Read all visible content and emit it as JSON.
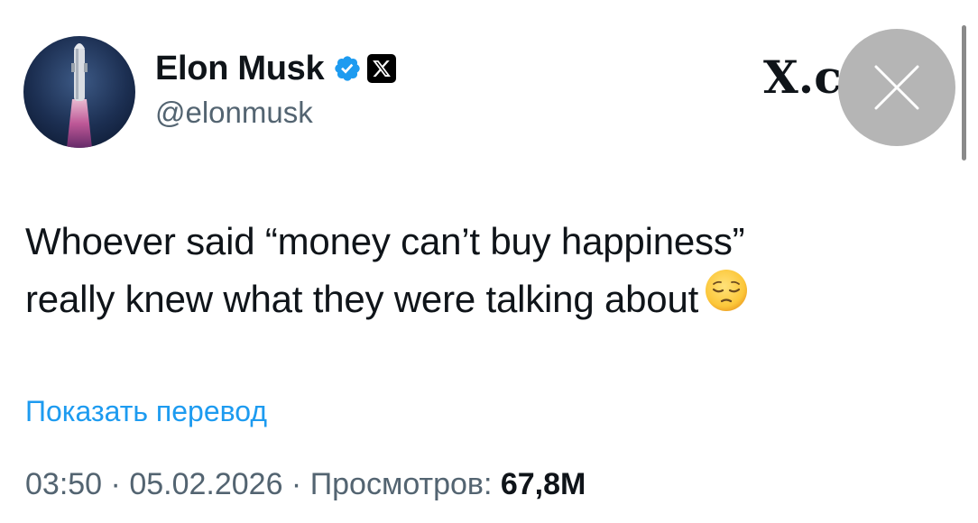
{
  "author": {
    "name": "Elon Musk",
    "handle": "@elonmusk",
    "avatar_icon": "rocket-launch-avatar",
    "verified_icon": "verified-badge-icon",
    "affiliation_icon": "x-logo-icon"
  },
  "watermark": {
    "text": "X.c"
  },
  "overlay": {
    "close_icon": "close-icon"
  },
  "tweet": {
    "line1": "Whoever said “money can’t buy happiness”",
    "line2": "really knew what they were talking about",
    "emoji": "pensive-face-emoji"
  },
  "translate": {
    "label": "Показать перевод"
  },
  "meta": {
    "time": "03:50",
    "separator": " · ",
    "date": "05.02.2026",
    "views_label": "Просмотров:",
    "views_count": "67,8M"
  },
  "colors": {
    "text": "#0f1419",
    "secondary": "#536471",
    "link": "#1d9bf0",
    "verified": "#1d9bf0",
    "background": "#ffffff"
  }
}
